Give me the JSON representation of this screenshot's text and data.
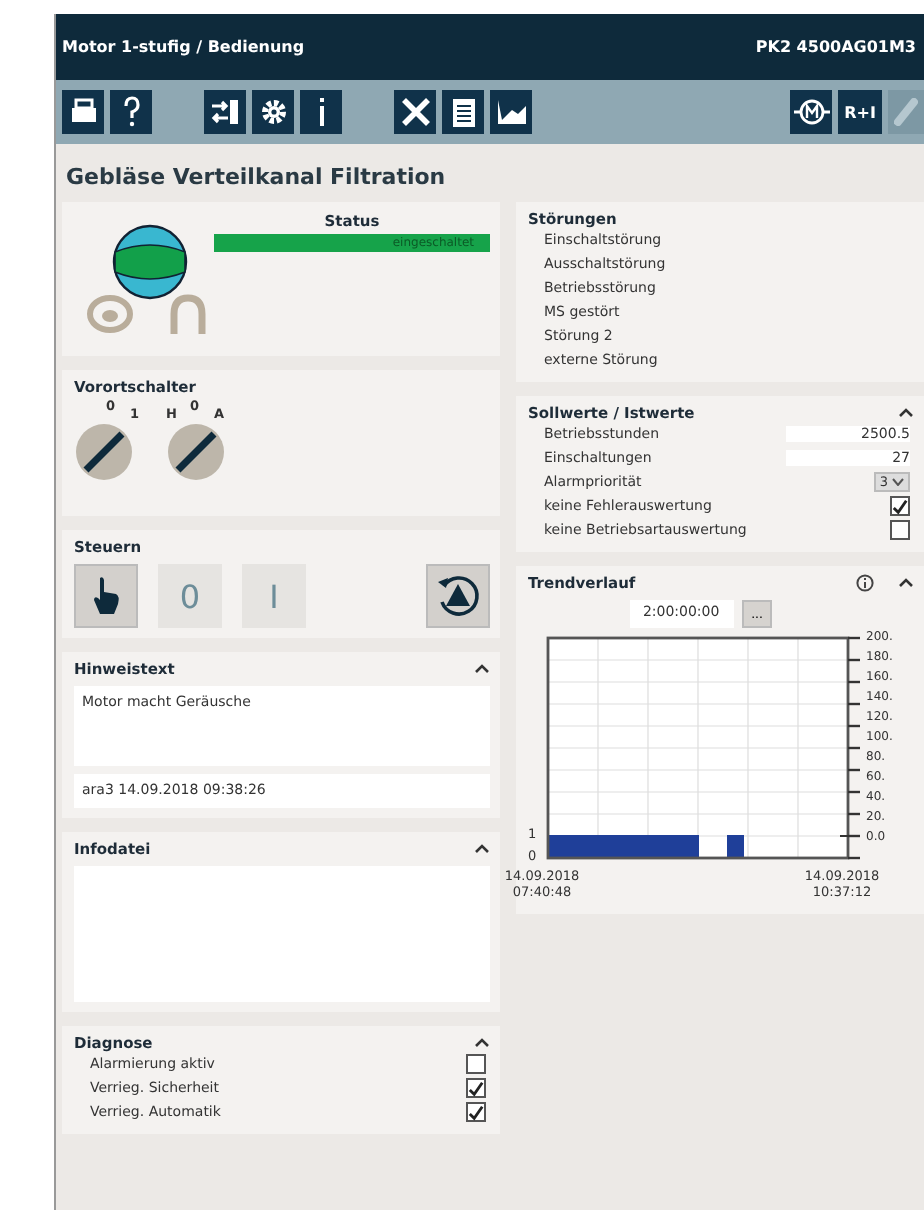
{
  "window": {
    "title": "Motor 1-stufig / Bedienung",
    "id_label": "PK2 4500AG01M3"
  },
  "toolbar": {
    "groups": [
      [
        {
          "kind": "print"
        },
        {
          "kind": "help"
        }
      ],
      [
        {
          "kind": "exit"
        },
        {
          "kind": "settings"
        },
        {
          "kind": "info"
        }
      ],
      [
        {
          "kind": "tools"
        },
        {
          "kind": "document"
        },
        {
          "kind": "trend"
        }
      ],
      [
        {
          "kind": "motor"
        },
        {
          "kind": "text",
          "label": "R+I"
        },
        {
          "kind": "link"
        }
      ]
    ]
  },
  "page_title": "Gebläse Verteilkanal Filtration",
  "status": {
    "title": "Status",
    "text": "eingeschaltet",
    "color": "#16a34a"
  },
  "local_switch": {
    "title": "Vorortschalter",
    "switch_1_labels": [
      "0",
      "1"
    ],
    "switch_2_labels": [
      "H",
      "0",
      "A"
    ]
  },
  "control": {
    "title": "Steuern",
    "buttons": [
      {
        "kind": "hand",
        "selected": true
      },
      {
        "kind": "text",
        "label": "0",
        "selected": false
      },
      {
        "kind": "text",
        "label": "I",
        "selected": false
      }
    ]
  },
  "note": {
    "title": "Hinweistext",
    "text": "Motor macht Geräusche",
    "footer": "ara3 14.09.2018 09:38:26",
    "expanded": true
  },
  "info_file": {
    "title": "Infodatei",
    "expanded": true
  },
  "diagnosis": {
    "title": "Diagnose",
    "expanded": true,
    "items": [
      {
        "label": "Alarmierung aktiv",
        "checked": false
      },
      {
        "label": "Verrieg. Sicherheit",
        "checked": true
      },
      {
        "label": "Verrieg. Automatik",
        "checked": true
      }
    ]
  },
  "faults": {
    "title": "Störungen",
    "items": [
      "Einschaltstörung",
      "Ausschaltstörung",
      "Betriebsstörung",
      "MS gestört",
      "Störung 2",
      "externe Störung"
    ]
  },
  "setpoints": {
    "title": "Sollwerte / Istwerte",
    "expanded": true,
    "items": [
      {
        "kind": "value",
        "label": "Betriebsstunden",
        "value": "2500.5"
      },
      {
        "kind": "value",
        "label": "Einschaltungen",
        "value": "27"
      },
      {
        "kind": "select",
        "label": "Alarmpriorität",
        "value": "3"
      },
      {
        "kind": "check",
        "label": "keine Fehlerauswertung",
        "checked": true
      },
      {
        "kind": "check",
        "label": "keine Betriebsartauswertung",
        "checked": false
      }
    ]
  },
  "trend": {
    "title": "Trendverlauf",
    "expanded": true,
    "range": "2:00:00:00",
    "range_button": "...",
    "right_axis_labels": [
      "200.",
      "180.",
      "160.",
      "140.",
      "120.",
      "100.",
      "80.",
      "60.",
      "40.",
      "20.",
      "0.0"
    ],
    "chart_data": {
      "type": "area",
      "categories": [
        "14.09.2018 07:40:48",
        null,
        null,
        null,
        null,
        null,
        null,
        null,
        null,
        null,
        null,
        null,
        null,
        null,
        null,
        null,
        null,
        null,
        null,
        null,
        "14.09.2018 10:37:12"
      ],
      "series": [
        {
          "color": "#1f3f99",
          "values": [
            1,
            1,
            1,
            1,
            1,
            1,
            1,
            1,
            1,
            1,
            0,
            0,
            1,
            0,
            0,
            0,
            0,
            0,
            0,
            0,
            0
          ]
        }
      ],
      "ylim": [
        0,
        10
      ],
      "yticks": [
        0,
        1
      ],
      "grid": true
    }
  }
}
